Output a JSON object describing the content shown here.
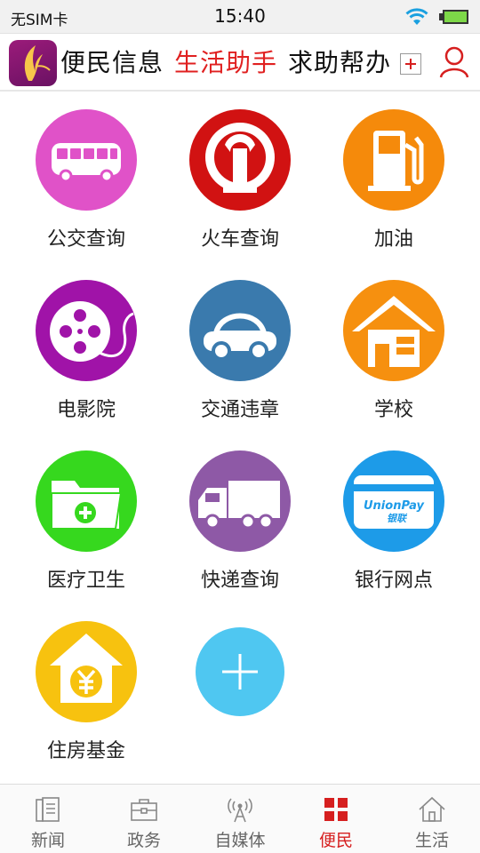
{
  "status_bar": {
    "carrier": "无SIM卡",
    "time": "15:40",
    "wifi_icon": "wifi-icon",
    "battery_icon": "battery-icon"
  },
  "header": {
    "logo_icon": "fugu-logo",
    "tabs": [
      {
        "label": "便民信息",
        "active": false
      },
      {
        "label": "生活助手",
        "active": true
      },
      {
        "label": "求助帮办",
        "active": false
      }
    ],
    "add_icon": "plus-box-icon",
    "user_icon": "user-icon",
    "active_color": "#e02020"
  },
  "services": [
    {
      "label": "公交查询",
      "icon": "bus-icon",
      "color": "#e052c8"
    },
    {
      "label": "火车查询",
      "icon": "railway-icon",
      "color": "#d11212"
    },
    {
      "label": "加油",
      "icon": "fuel-pump-icon",
      "color": "#f58a0b"
    },
    {
      "label": "电影院",
      "icon": "film-reel-icon",
      "color": "#a013a8"
    },
    {
      "label": "交通违章",
      "icon": "car-icon",
      "color": "#3a7aad"
    },
    {
      "label": "学校",
      "icon": "house-icon",
      "color": "#f6900f"
    },
    {
      "label": "医疗卫生",
      "icon": "medical-folder-icon",
      "color": "#36d81e"
    },
    {
      "label": "快递查询",
      "icon": "truck-icon",
      "color": "#8e59a6"
    },
    {
      "label": "银行网点",
      "icon": "unionpay-card-icon",
      "color": "#1d9be8"
    },
    {
      "label": "住房基金",
      "icon": "housing-fund-icon",
      "color": "#f7c20f"
    },
    {
      "label": "",
      "icon": "add-service-icon",
      "color": "#4fc7f1"
    }
  ],
  "tabbar": {
    "tabs": [
      {
        "label": "新闻",
        "icon": "news-icon",
        "active": false
      },
      {
        "label": "政务",
        "icon": "briefcase-icon",
        "active": false
      },
      {
        "label": "自媒体",
        "icon": "broadcast-icon",
        "active": false
      },
      {
        "label": "便民",
        "icon": "grid-icon",
        "active": true
      },
      {
        "label": "生活",
        "icon": "home-icon",
        "active": false
      }
    ],
    "active_color": "#d61f1f"
  }
}
